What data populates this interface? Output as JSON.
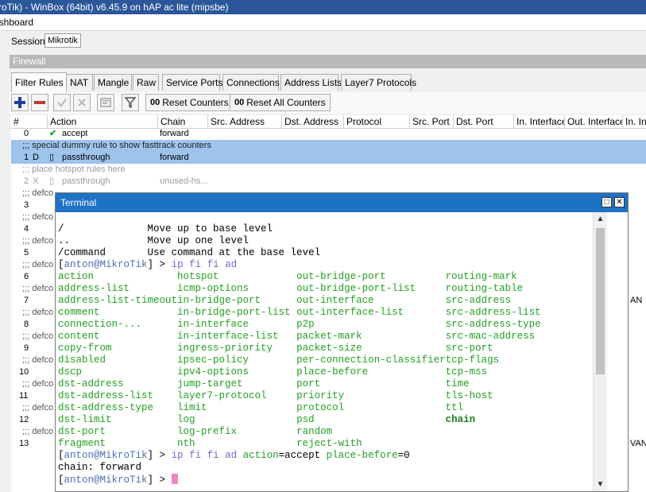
{
  "window_title": "kroTik) - WinBox (64bit) v6.45.9 on hAP ac lite (mipsbe)",
  "menu_item": "ashboard",
  "session": {
    "label": "Session:",
    "value": "Mikrotik"
  },
  "panel_title": "Firewall",
  "tabs": [
    "Filter Rules",
    "NAT",
    "Mangle",
    "Raw",
    "Service Ports",
    "Connections",
    "Address Lists",
    "Layer7 Protocols"
  ],
  "toolbar": {
    "reset_counters": "Reset Counters",
    "reset_all_counters": "Reset All Counters",
    "counter_icon": "00"
  },
  "columns": [
    "#",
    "Action",
    "Chain",
    "Src. Address",
    "Dst. Address",
    "Protocol",
    "Src. Port",
    "Dst. Port",
    "In. Interface",
    "Out. Interface",
    "In. Inte"
  ],
  "rows": [
    {
      "num": "0",
      "flag": "",
      "action": "accept",
      "chain": "forward"
    },
    {
      "comment": ";;; special dummy rule to show fasttrack counters"
    },
    {
      "num": "1",
      "flag": "D",
      "action": "passthrough",
      "chain": "forward"
    },
    {
      "comment": ";;; place hotspot rules here"
    },
    {
      "num": "2",
      "flag": "X",
      "action": "passthrough",
      "chain": "unused-hs..."
    },
    {
      "comment": ";;; defco"
    },
    {
      "num": "3"
    },
    {
      "comment": ";;; defco"
    },
    {
      "num": "4"
    },
    {
      "comment": ";;; defco"
    },
    {
      "num": "5"
    },
    {
      "comment": ";;; defco"
    },
    {
      "num": "6"
    },
    {
      "comment": ";;; defco"
    },
    {
      "num": "7",
      "tail": "AN"
    },
    {
      "comment": ";;; defco"
    },
    {
      "num": "8"
    },
    {
      "comment": ";;; defco"
    },
    {
      "num": "9"
    },
    {
      "comment": ";;; defco"
    },
    {
      "num": "10"
    },
    {
      "comment": ";;; defco"
    },
    {
      "num": "11"
    },
    {
      "comment": ";;; defco"
    },
    {
      "num": "12"
    },
    {
      "comment": ";;; defco"
    },
    {
      "num": "13",
      "tail": "VAN"
    }
  ],
  "terminal": {
    "title": "Terminal",
    "help": [
      {
        "cmd": "/",
        "desc": "Move up to base level"
      },
      {
        "cmd": "..",
        "desc": "Move up one level"
      },
      {
        "cmd": "/command",
        "desc": "Use command at the base level"
      }
    ],
    "prompt_user": "anton@MikroTik",
    "prompt1_cmd": "ip fi fi ad",
    "completions": [
      [
        "action",
        "hotspot",
        "out-bridge-port",
        "routing-mark"
      ],
      [
        "address-list",
        "icmp-options",
        "out-bridge-port-list",
        "routing-table"
      ],
      [
        "address-list-timeout",
        "in-bridge-port",
        "out-interface",
        "src-address"
      ],
      [
        "comment",
        "in-bridge-port-list",
        "out-interface-list",
        "src-address-list"
      ],
      [
        "connection-...",
        "in-interface",
        "p2p",
        "src-address-type"
      ],
      [
        "content",
        "in-interface-list",
        "packet-mark",
        "src-mac-address"
      ],
      [
        "copy-from",
        "ingress-priority",
        "packet-size",
        "src-port"
      ],
      [
        "disabled",
        "ipsec-policy",
        "per-connection-classifier",
        "tcp-flags"
      ],
      [
        "dscp",
        "ipv4-options",
        "place-before",
        "tcp-mss"
      ],
      [
        "dst-address",
        "jump-target",
        "port",
        "time"
      ],
      [
        "dst-address-list",
        "layer7-protocol",
        "priority",
        "tls-host"
      ],
      [
        "dst-address-type",
        "limit",
        "protocol",
        "ttl"
      ],
      [
        "dst-limit",
        "log",
        "psd",
        "chain"
      ],
      [
        "dst-port",
        "log-prefix",
        "random",
        ""
      ],
      [
        "fragment",
        "nth",
        "reject-with",
        ""
      ]
    ],
    "prompt2_cmd": "ip fi fi ad",
    "prompt2_args": [
      {
        "key": "action",
        "value": "accept"
      },
      {
        "key": "place-before",
        "value": "0"
      }
    ],
    "output": "chain: forward"
  }
}
